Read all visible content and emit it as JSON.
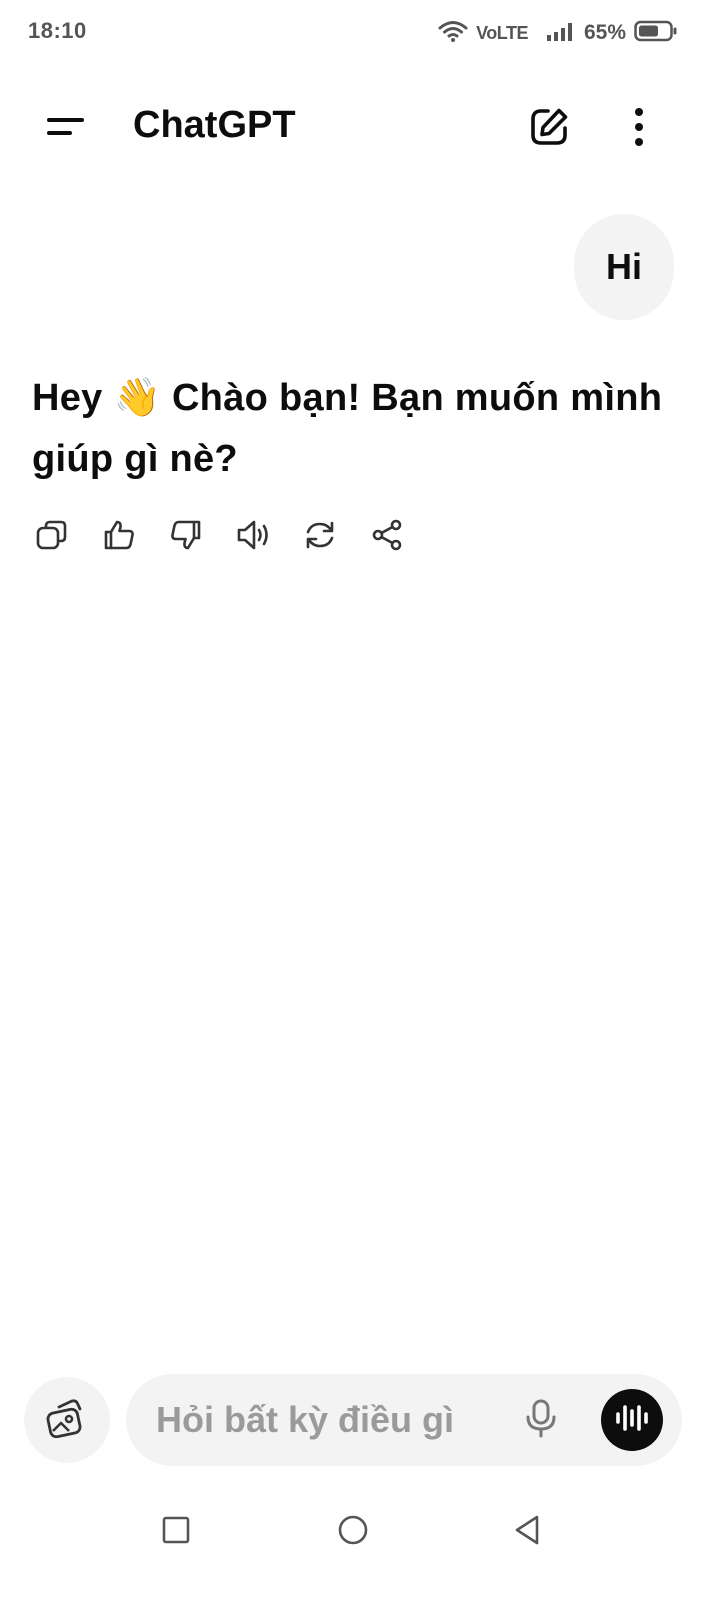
{
  "status_bar": {
    "time": "18:10",
    "network_label": "VoLTE",
    "battery_percent": "65%",
    "battery_level": 0.65,
    "icons": [
      "wifi-icon",
      "signal-icon",
      "battery-icon"
    ]
  },
  "header": {
    "title": "ChatGPT",
    "icons": [
      "menu-icon",
      "new-chat-icon",
      "more-vertical-icon"
    ]
  },
  "conversation": {
    "user_message": "Hi",
    "assistant_message": "Hey 👋 Chào bạn! Bạn muốn mình giúp gì nè?",
    "actions": [
      "copy-icon",
      "thumbs-up-icon",
      "thumbs-down-icon",
      "speaker-icon",
      "regenerate-icon",
      "share-icon"
    ]
  },
  "composer": {
    "placeholder": "Hỏi bất kỳ điều gì",
    "value": "",
    "icons": [
      "image-attach-icon",
      "microphone-icon",
      "voice-mode-icon"
    ]
  },
  "nav_bar": {
    "icons": [
      "recents-icon",
      "home-icon",
      "back-icon"
    ]
  },
  "colors": {
    "text": "#0d0d0d",
    "muted": "#555555",
    "placeholder": "#9a9a9a",
    "surface": "#f3f3f3",
    "background": "#ffffff"
  }
}
